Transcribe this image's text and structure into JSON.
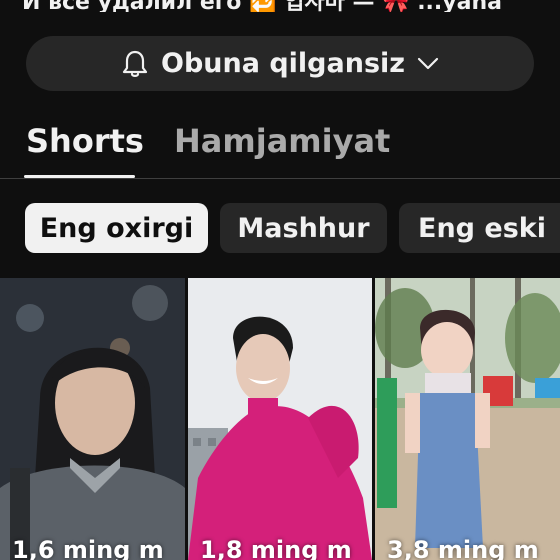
{
  "header_partial_text": "И все удалил его 🔁 입사마 — 🎀 ...yana",
  "subscribe": {
    "label": "Obuna qilgansiz",
    "icon": "bell-icon",
    "chevron": "chevron-down-icon"
  },
  "tabs": [
    {
      "label": "Shorts",
      "selected": true
    },
    {
      "label": "Hamjamiyat",
      "selected": false
    }
  ],
  "filters": [
    {
      "label": "Eng oxirgi",
      "selected": true
    },
    {
      "label": "Mashhur",
      "selected": false
    },
    {
      "label": "Eng eski",
      "selected": false
    }
  ],
  "shorts": [
    {
      "views": "1,6 ming m"
    },
    {
      "views": "1,8 ming m"
    },
    {
      "views": "3,8 ming m"
    }
  ],
  "colors": {
    "background": "#0f0f0f",
    "chip_selected": "#f1f1f1",
    "chip": "#272727"
  }
}
